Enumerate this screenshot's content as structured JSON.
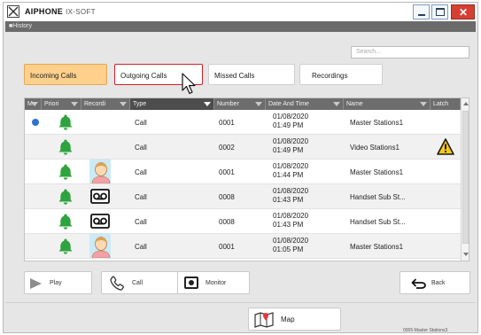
{
  "window": {
    "brand": "AIPHONE",
    "product": "IX-SOFT",
    "min_icon": "minimize-icon",
    "max_icon": "maximize-icon",
    "close_icon": "close-icon",
    "close_color": "#d53f32"
  },
  "history_bar": {
    "label": "■History"
  },
  "search": {
    "placeholder": "Search..."
  },
  "tabs": [
    {
      "label": "Incoming Calls",
      "active": true
    },
    {
      "label": "Outgoing Calls",
      "active": false
    },
    {
      "label": "Missed Calls",
      "active": false
    },
    {
      "label": "Recordings",
      "active": false
    }
  ],
  "table": {
    "columns": [
      "M",
      "Priori",
      "Recordi",
      "Type",
      "Number",
      "Date And Time",
      "Name",
      "Latch"
    ],
    "rows": [
      {
        "unread": true,
        "priority_icon": "bell-icon",
        "recording": "",
        "type": "Call",
        "number": "0001",
        "date": "01/08/2020",
        "time": "01:49 PM",
        "name": "Master Stations1",
        "latch": ""
      },
      {
        "unread": false,
        "priority_icon": "bell-icon",
        "recording": "",
        "type": "Call",
        "number": "0002",
        "date": "01/08/2020",
        "time": "01:49 PM",
        "name": "Video Stations1",
        "latch": "warning-icon"
      },
      {
        "unread": false,
        "priority_icon": "bell-icon",
        "recording": "person-snapshot-icon",
        "type": "Call",
        "number": "0001",
        "date": "01/08/2020",
        "time": "01:44 PM",
        "name": "Master Stations1",
        "latch": ""
      },
      {
        "unread": false,
        "priority_icon": "bell-icon",
        "recording": "voicemail-tape-icon",
        "type": "Call",
        "number": "0008",
        "date": "01/08/2020",
        "time": "01:43 PM",
        "name": "Handset Sub St...",
        "latch": ""
      },
      {
        "unread": false,
        "priority_icon": "bell-icon",
        "recording": "voicemail-tape-icon",
        "type": "Call",
        "number": "0008",
        "date": "01/08/2020",
        "time": "01:43 PM",
        "name": "Handset Sub St...",
        "latch": ""
      },
      {
        "unread": false,
        "priority_icon": "bell-icon",
        "recording": "person-snapshot-icon",
        "type": "Call",
        "number": "0001",
        "date": "01/08/2020",
        "time": "01:05 PM",
        "name": "Master Stations1",
        "latch": ""
      }
    ]
  },
  "buttons": {
    "play": "Play",
    "call": "Call",
    "monitor": "Monitor",
    "back": "Back",
    "map": "Map"
  },
  "status": {
    "station": "0005-Master Stations3"
  },
  "colors": {
    "active_tab": "#ffd08c",
    "bell": "#2ea33e",
    "unread_dot": "#2b74d3",
    "table_header": "#6d6d6d",
    "focus_outline": "#d21f26"
  }
}
